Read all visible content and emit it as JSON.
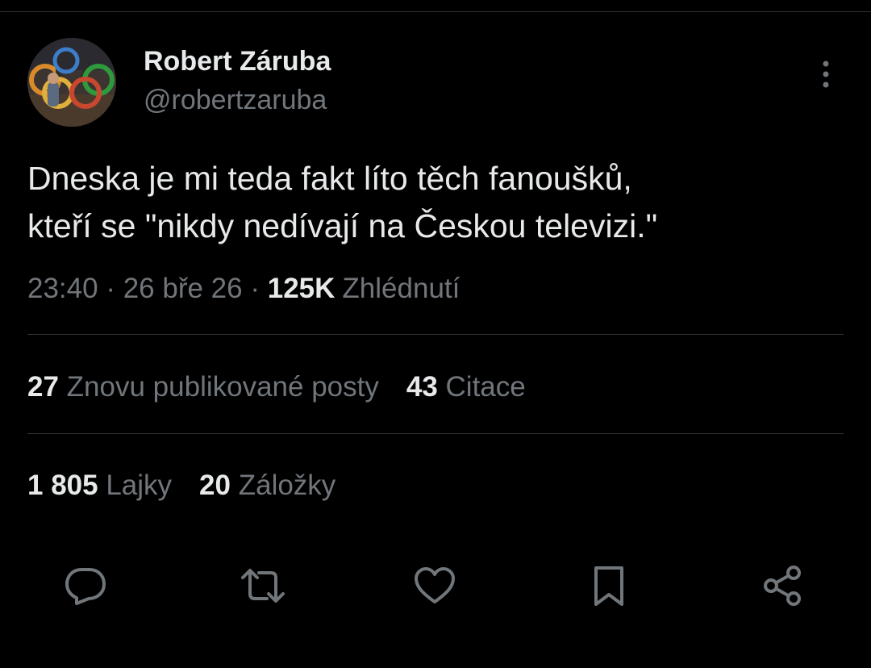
{
  "author": {
    "display_name": "Robert Záruba",
    "handle": "@robertzaruba"
  },
  "post": {
    "text": "Dneska je mi teda fakt líto těch fanoušků,\nkteří se \"nikdy nedívají na Českou televizi.\"",
    "time": "23:40",
    "separator": "·",
    "date": "26 bře 26",
    "views_count": "125K",
    "views_label": "Zhlédnutí"
  },
  "stats": {
    "reposts_count": "27",
    "reposts_label": "Znovu publikované posty",
    "quotes_count": "43",
    "quotes_label": "Citace",
    "likes_count": "1 805",
    "likes_label": "Lajky",
    "bookmarks_count": "20",
    "bookmarks_label": "Záložky"
  },
  "actions": [
    "reply-icon",
    "repost-icon",
    "like-icon",
    "bookmark-icon",
    "share-icon"
  ],
  "colors": {
    "background": "#000000",
    "primary_text": "#e7e9ea",
    "secondary_text": "#71767b",
    "divider": "#2f3336"
  }
}
